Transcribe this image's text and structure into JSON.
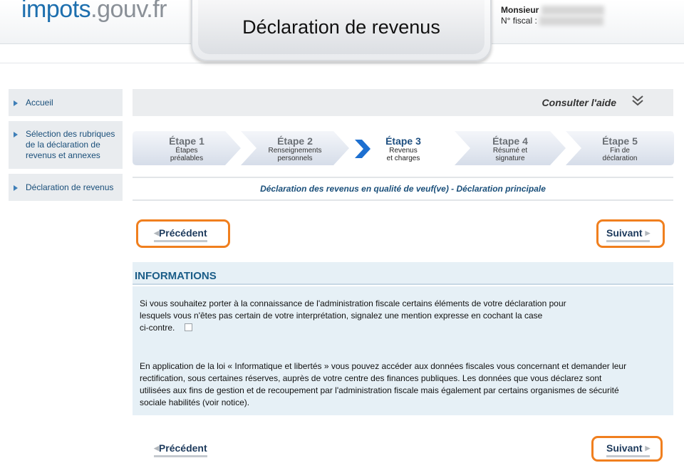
{
  "header": {
    "logo_main": "impots",
    "logo_domain": ".gouv.fr",
    "title": "Déclaration de revenus",
    "user_name": "Monsieur",
    "fiscal_label": "N° fiscal :"
  },
  "sidebar": {
    "items": [
      {
        "label": "Accueil"
      },
      {
        "label": "Sélection des rubriques de la déclaration de revenus et annexes"
      },
      {
        "label": "Déclaration de revenus"
      }
    ]
  },
  "help": {
    "label": "Consulter l'aide"
  },
  "steps": [
    {
      "title": "Étape 1",
      "sub1": "Étapes",
      "sub2": "préalables"
    },
    {
      "title": "Étape 2",
      "sub1": "Renseignements",
      "sub2": "personnels"
    },
    {
      "title": "Étape 3",
      "sub1": "Revenus",
      "sub2": "et charges"
    },
    {
      "title": "Étape 4",
      "sub1": "Résumé et",
      "sub2": "signature"
    },
    {
      "title": "Étape 5",
      "sub1": "Fin de",
      "sub2": "déclaration"
    }
  ],
  "active_step": 3,
  "context_title": "Déclaration des revenus en qualité de veuf(ve) - Déclaration principale",
  "navigation": {
    "previous": "Précédent",
    "next": "Suivant"
  },
  "info": {
    "heading": "INFORMATIONS",
    "para1_line1": "Si vous souhaitez porter à la connaissance de l'administration fiscale certains éléments de votre déclaration pour",
    "para1_line2": "lesquels vous n'êtes pas certain de votre interprétation, signalez une mention expresse en cochant la case",
    "para1_line3": "ci-contre.",
    "checkbox_checked": false,
    "para2_line1": "En application de la loi « Informatique et libertés » vous pouvez accéder aux données fiscales vous concernant et demander leur",
    "para2_line2": "rectification, sous certaines réserves, auprès de votre centre des finances publiques. Les données que vous déclarez sont",
    "para2_line3": "utilisées aux fins de gestion et de recoupement par l'administration fiscale mais également par certains organismes de sécurité",
    "para2_line4": "sociale habilités (voir notice)."
  },
  "colors": {
    "accent_orange": "#f07f1e",
    "link_blue": "#1a4f7a",
    "active_arrow": "#1d6fd0",
    "info_bg": "#e6f0f6"
  }
}
